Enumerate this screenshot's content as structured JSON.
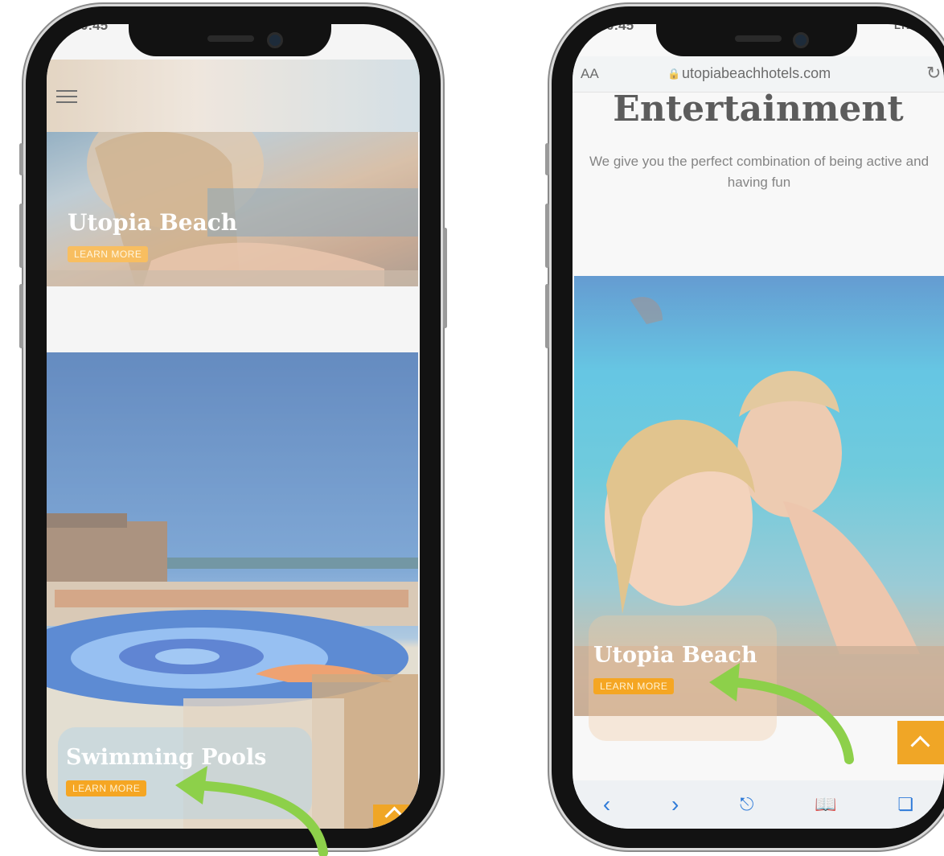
{
  "left_phone": {
    "status_time": "0:45",
    "menu_icon": "hamburger-menu-icon",
    "banners": [
      {
        "title": "Utopia Beach",
        "button_label": "LEARN MORE"
      },
      {
        "title": "Swimming Pools",
        "button_label": "LEARN MORE"
      }
    ]
  },
  "right_phone": {
    "status_time": "0:45",
    "signal_label": "LTE",
    "address_bar": {
      "aa_label": "AA",
      "url": "utopiabeachhotels.com"
    },
    "section": {
      "title": "Entertainment",
      "subtitle": "We give you the perfect combination of being active and having fun"
    },
    "banner": {
      "title": "Utopia Beach",
      "button_label": "LEARN MORE"
    },
    "toolbar_icons": [
      "back-icon",
      "forward-icon",
      "share-icon",
      "bookmarks-icon",
      "tabs-icon"
    ]
  },
  "colors": {
    "accent": "#f5a623",
    "arrow": "#8dd04a",
    "link_blue": "#2f7bd8"
  }
}
